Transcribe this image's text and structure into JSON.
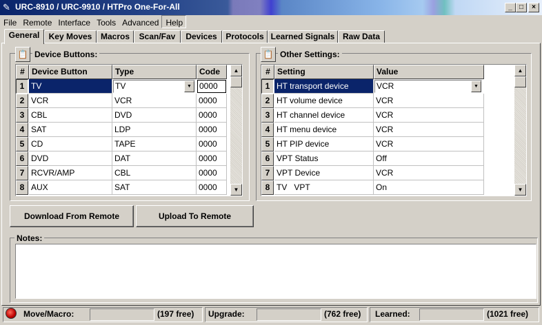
{
  "window": {
    "title": "URC-8910 / URC-9910 / HTPro One-For-All",
    "minimize": "_",
    "maximize": "□",
    "close": "×"
  },
  "menu": [
    "File",
    "Remote",
    "Interface",
    "Tools",
    "Advanced",
    "Help"
  ],
  "tabs": [
    "General",
    "Key Moves",
    "Macros",
    "Scan/Fav",
    "Devices",
    "Protocols",
    "Learned Signals",
    "Raw Data"
  ],
  "device_buttons": {
    "label": "Device Buttons:",
    "columns": [
      "#",
      "Device Button",
      "Type",
      "Code"
    ],
    "rows": [
      {
        "n": "1",
        "button": "TV",
        "type": "TV",
        "code": "0000"
      },
      {
        "n": "2",
        "button": "VCR",
        "type": "VCR",
        "code": "0000"
      },
      {
        "n": "3",
        "button": "CBL",
        "type": "DVD",
        "code": "0000"
      },
      {
        "n": "4",
        "button": "SAT",
        "type": "LDP",
        "code": "0000"
      },
      {
        "n": "5",
        "button": "CD",
        "type": "TAPE",
        "code": "0000"
      },
      {
        "n": "6",
        "button": "DVD",
        "type": "DAT",
        "code": "0000"
      },
      {
        "n": "7",
        "button": "RCVR/AMP",
        "type": "CBL",
        "code": "0000"
      },
      {
        "n": "8",
        "button": "AUX",
        "type": "SAT",
        "code": "0000"
      }
    ]
  },
  "other_settings": {
    "label": "Other Settings:",
    "columns": [
      "#",
      "Setting",
      "Value"
    ],
    "rows": [
      {
        "n": "1",
        "setting": "HT transport device",
        "value": "VCR"
      },
      {
        "n": "2",
        "setting": "HT volume device",
        "value": "VCR"
      },
      {
        "n": "3",
        "setting": "HT channel device",
        "value": "VCR"
      },
      {
        "n": "4",
        "setting": "HT menu device",
        "value": "VCR"
      },
      {
        "n": "5",
        "setting": "HT PIP device",
        "value": "VCR"
      },
      {
        "n": "6",
        "setting": "VPT Status",
        "value": "Off"
      },
      {
        "n": "7",
        "setting": "VPT Device",
        "value": "VCR"
      },
      {
        "n": "8",
        "setting": "TV   VPT",
        "value": "On"
      }
    ]
  },
  "buttons": {
    "download": "Download From Remote",
    "upload": "Upload To Remote"
  },
  "notes": {
    "label": "Notes:",
    "value": ""
  },
  "status": {
    "move_label": "Move/Macro:",
    "move_free": "(197 free)",
    "upgrade_label": "Upgrade:",
    "upgrade_free": "(762 free)",
    "learned_label": "Learned:",
    "learned_free": "(1021 free)"
  }
}
